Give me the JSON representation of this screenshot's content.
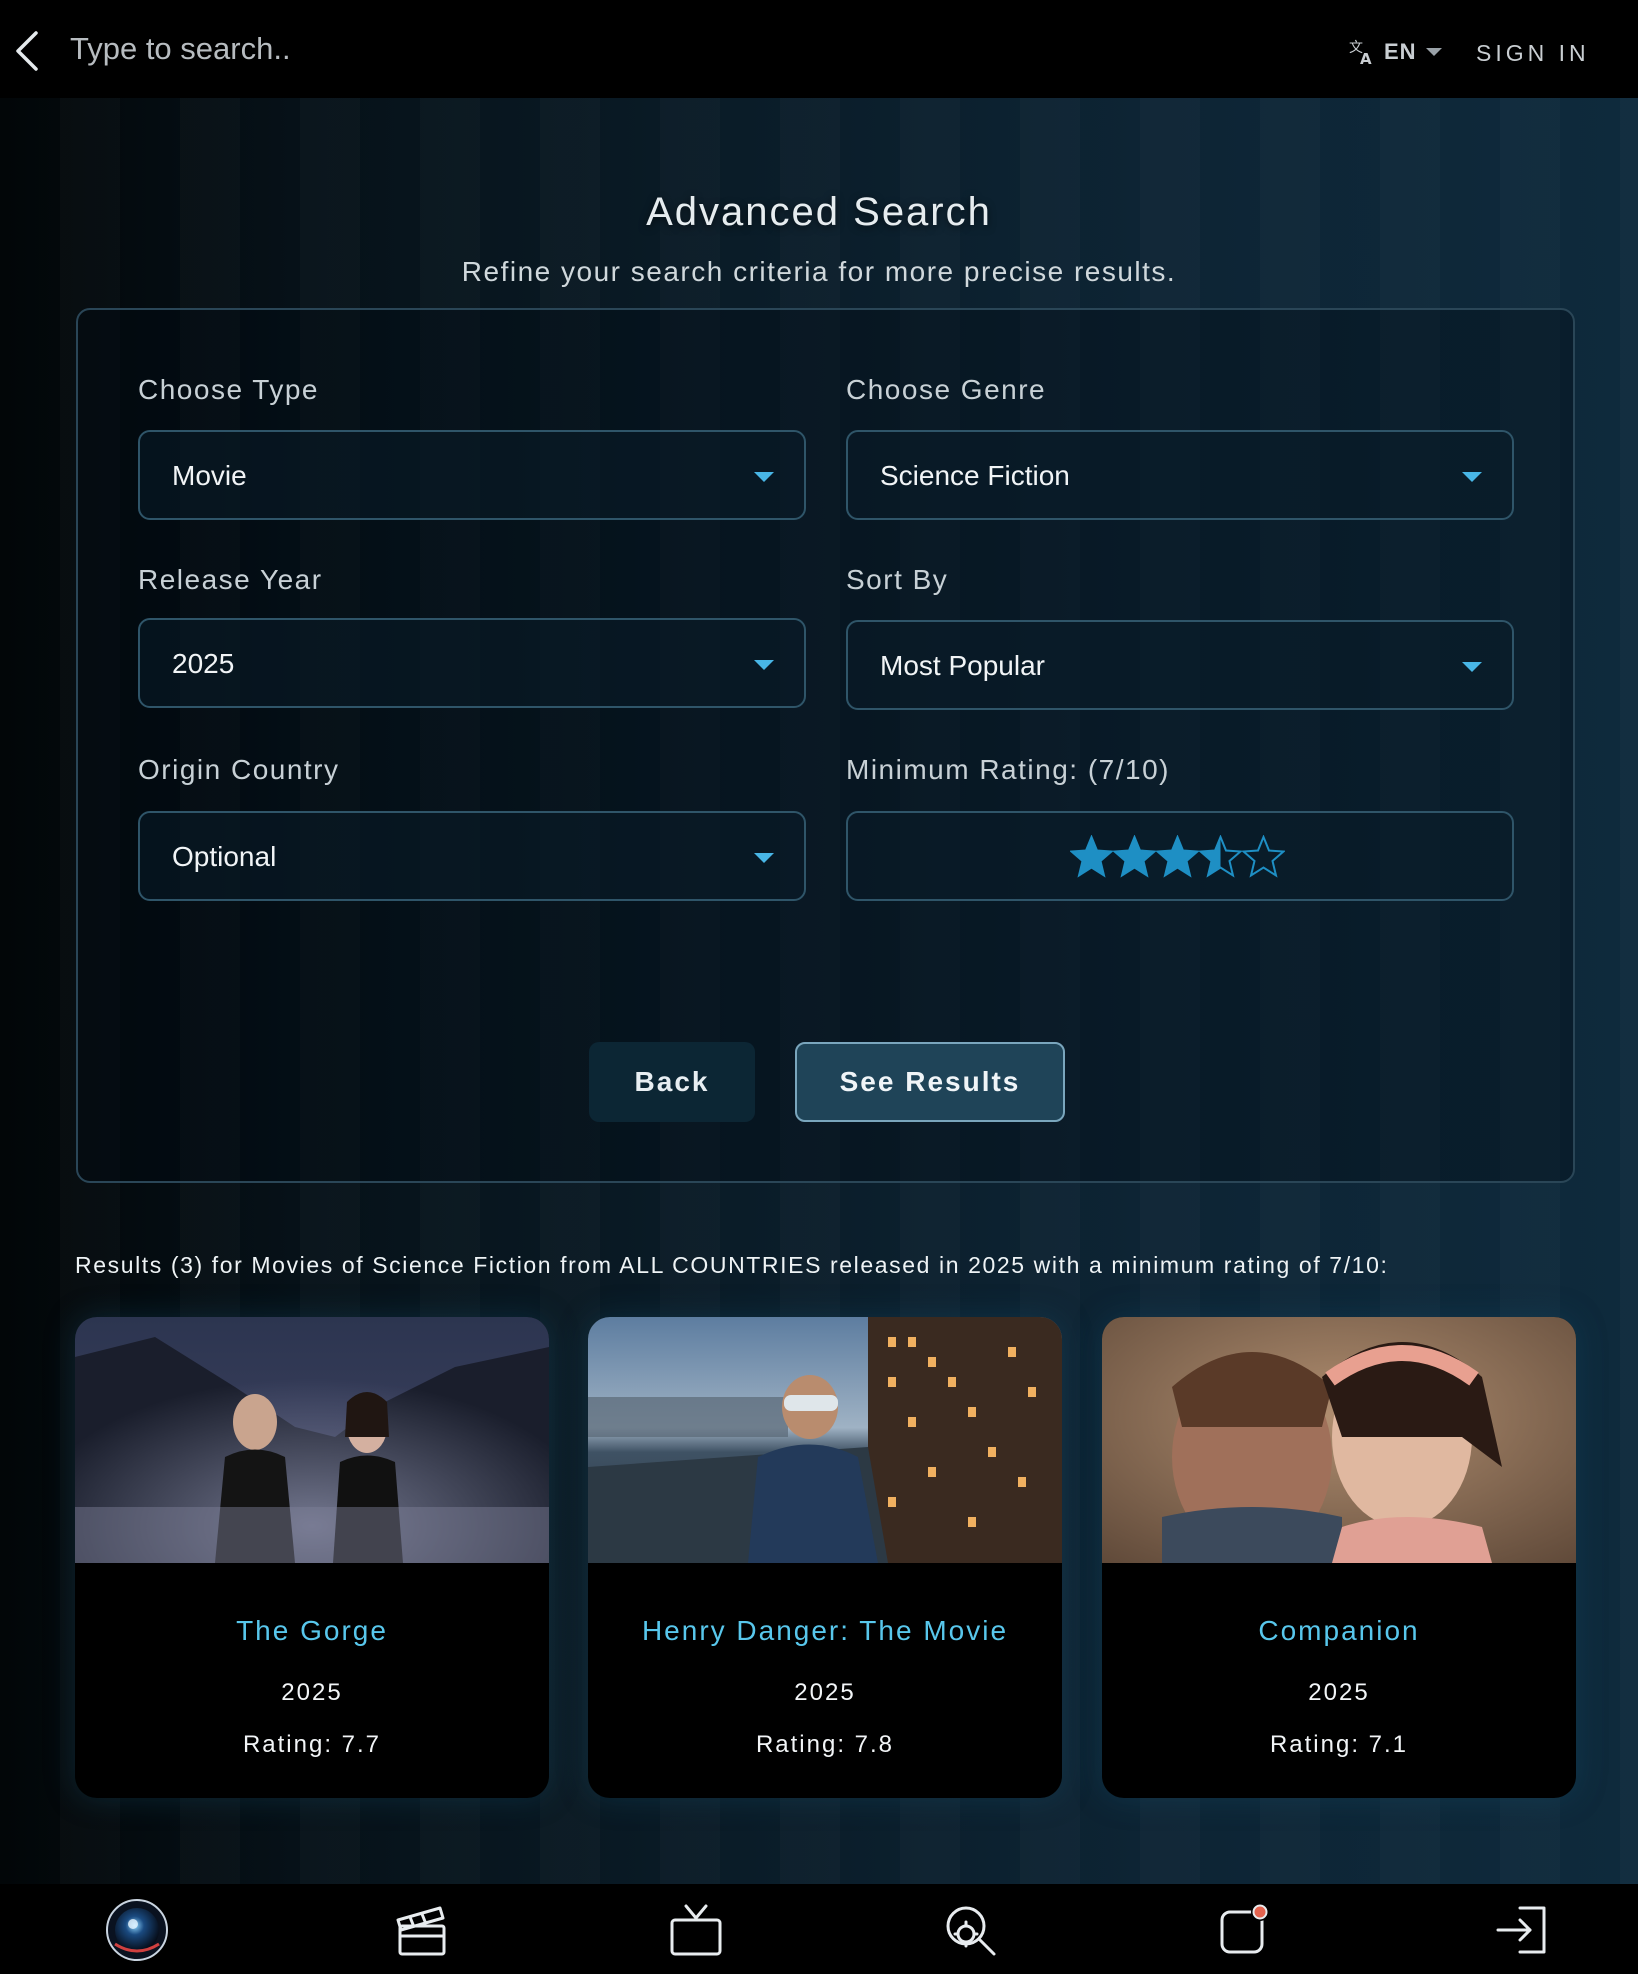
{
  "topbar": {
    "search_placeholder": "Type to search..",
    "language": "EN",
    "sign_in": "SIGN IN"
  },
  "page": {
    "title": "Advanced Search",
    "subtitle": "Refine your search criteria for more precise results."
  },
  "form": {
    "type": {
      "label": "Choose Type",
      "value": "Movie"
    },
    "genre": {
      "label": "Choose Genre",
      "value": "Science Fiction"
    },
    "year": {
      "label": "Release Year",
      "value": "2025"
    },
    "sort": {
      "label": "Sort By",
      "value": "Most Popular"
    },
    "country": {
      "label": "Origin Country",
      "value": "Optional"
    },
    "rating": {
      "label": "Minimum Rating: (7/10)",
      "value": 7,
      "max": 10,
      "stars_filled": 3.5,
      "stars_total": 5
    },
    "back_button": "Back",
    "results_button": "See Results"
  },
  "results": {
    "summary": "Results (3) for Movies of Science Fiction from ALL COUNTRIES released in 2025 with a minimum rating of 7/10:",
    "items": [
      {
        "title": "The Gorge",
        "year": "2025",
        "rating": "Rating: 7.7"
      },
      {
        "title": "Henry Danger: The Movie",
        "year": "2025",
        "rating": "Rating: 7.8"
      },
      {
        "title": "Companion",
        "year": "2025",
        "rating": "Rating: 7.1"
      }
    ]
  },
  "colors": {
    "accent": "#48b6e6",
    "card_title": "#58c7ec",
    "star": "#1e8fc4",
    "panel_border": "#2a4657"
  },
  "bottom_nav": {
    "icons": [
      "app-logo-icon",
      "clapperboard-icon",
      "tv-icon",
      "search-gear-icon",
      "notification-icon",
      "sign-in-icon"
    ]
  }
}
